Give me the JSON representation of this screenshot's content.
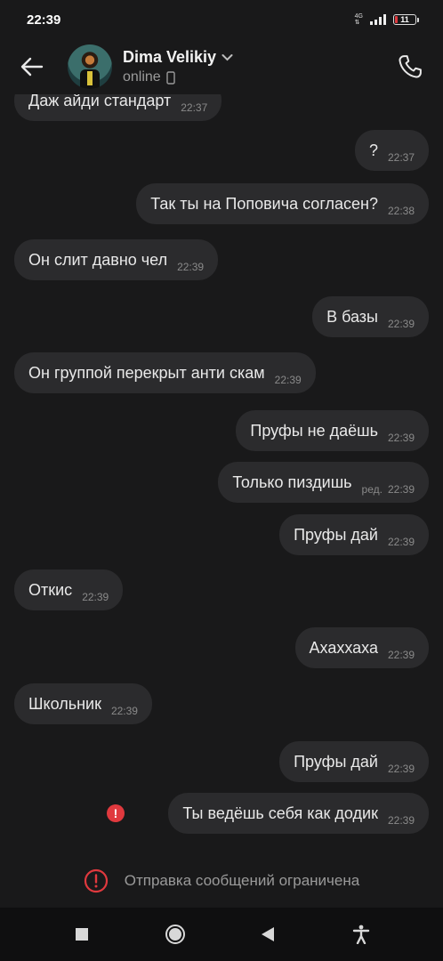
{
  "status_bar": {
    "time": "22:39",
    "network": "4G",
    "battery": "11",
    "battery_level": 0.11
  },
  "header": {
    "contact_name": "Dima Velikiy",
    "presence": "online"
  },
  "messages": [
    {
      "dir": "in",
      "text": "Даж айди стандарт",
      "time": "22:37"
    },
    {
      "dir": "out",
      "text": "?",
      "time": "22:37"
    },
    {
      "dir": "out",
      "text": "Так ты на Поповича согласен?",
      "time": "22:38"
    },
    {
      "dir": "in",
      "text": "Он слит давно чел",
      "time": "22:39"
    },
    {
      "dir": "out",
      "text": "В базы",
      "time": "22:39"
    },
    {
      "dir": "in",
      "text": "Он группой перекрыт анти скам",
      "time": "22:39"
    },
    {
      "dir": "out",
      "text": "Пруфы не даёшь",
      "time": "22:39"
    },
    {
      "dir": "out",
      "text": "Только пиздишь",
      "time": "22:39",
      "edited": "ред."
    },
    {
      "dir": "out",
      "text": "Пруфы дай",
      "time": "22:39"
    },
    {
      "dir": "in",
      "text": "Откис",
      "time": "22:39"
    },
    {
      "dir": "out",
      "text": "Ахаххаха",
      "time": "22:39"
    },
    {
      "dir": "in",
      "text": "Школьник",
      "time": "22:39"
    },
    {
      "dir": "out",
      "text": "Пруфы дай",
      "time": "22:39"
    },
    {
      "dir": "out",
      "text": "Ты ведёшь себя как додик",
      "time": "22:39",
      "failed": true,
      "error_mark": "!"
    }
  ],
  "composer": {
    "restricted_text": "Отправка сообщений ограничена"
  },
  "colors": {
    "background": "#19191a",
    "bubble": "#2b2b2d",
    "error": "#e0393e",
    "secondary_text": "#8a8a8a"
  },
  "icons": {
    "back": "arrow-left-icon",
    "dropdown": "chevron-down-icon",
    "device": "phone-device-icon",
    "call": "phone-call-icon",
    "error": "alert-circle-icon",
    "nav": [
      "square-recents-icon",
      "circle-home-icon",
      "triangle-back-icon",
      "accessibility-icon"
    ]
  }
}
